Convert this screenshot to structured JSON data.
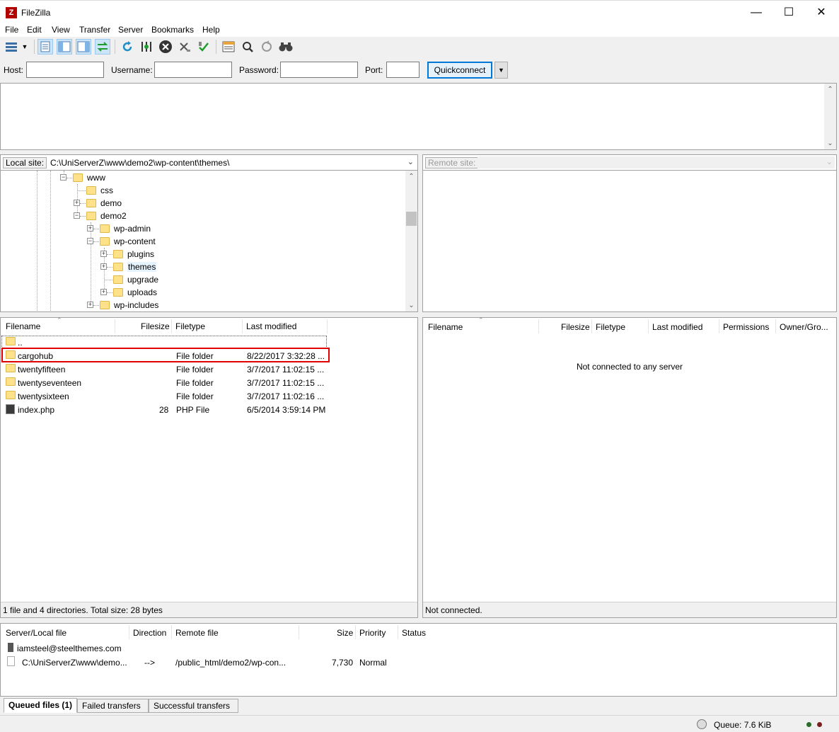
{
  "window": {
    "title": "FileZilla",
    "icon_text": "Z"
  },
  "menu": [
    "File",
    "Edit",
    "View",
    "Transfer",
    "Server",
    "Bookmarks",
    "Help"
  ],
  "quickconnect": {
    "host_label": "Host:",
    "username_label": "Username:",
    "password_label": "Password:",
    "port_label": "Port:",
    "button": "Quickconnect",
    "host": "",
    "username": "",
    "password": "",
    "port": ""
  },
  "local": {
    "label": "Local site:",
    "path": "C:\\UniServerZ\\www\\demo2\\wp-content\\themes\\",
    "tree": [
      "www",
      "css",
      "demo",
      "demo2",
      "wp-admin",
      "wp-content",
      "plugins",
      "themes",
      "upgrade",
      "uploads",
      "wp-includes"
    ],
    "columns": [
      "Filename",
      "Filesize",
      "Filetype",
      "Last modified"
    ],
    "files": [
      {
        "name": "..",
        "size": "",
        "type": "",
        "modified": ""
      },
      {
        "name": "cargohub",
        "size": "",
        "type": "File folder",
        "modified": "8/22/2017 3:32:28 ..."
      },
      {
        "name": "twentyfifteen",
        "size": "",
        "type": "File folder",
        "modified": "3/7/2017 11:02:15 ..."
      },
      {
        "name": "twentyseventeen",
        "size": "",
        "type": "File folder",
        "modified": "3/7/2017 11:02:15 ..."
      },
      {
        "name": "twentysixteen",
        "size": "",
        "type": "File folder",
        "modified": "3/7/2017 11:02:16 ..."
      },
      {
        "name": "index.php",
        "size": "28",
        "type": "PHP File",
        "modified": "6/5/2014 3:59:14 PM"
      }
    ],
    "status": "1 file and 4 directories. Total size: 28 bytes"
  },
  "remote": {
    "label": "Remote site:",
    "columns": [
      "Filename",
      "Filesize",
      "Filetype",
      "Last modified",
      "Permissions",
      "Owner/Gro..."
    ],
    "empty_message": "Not connected to any server",
    "status": "Not connected."
  },
  "queue": {
    "columns": [
      "Server/Local file",
      "Direction",
      "Remote file",
      "Size",
      "Priority",
      "Status"
    ],
    "server": "iamsteel@steelthemes.com",
    "item": {
      "local": "C:\\UniServerZ\\www\\demo...",
      "direction": "-->",
      "remote": "/public_html/demo2/wp-con...",
      "size": "7,730",
      "priority": "Normal"
    },
    "tabs": [
      "Queued files (1)",
      "Failed transfers",
      "Successful transfers"
    ]
  },
  "statusbar": {
    "queue": "Queue: 7.6 KiB"
  },
  "colors": {
    "highlight_box": "#e00000",
    "accent": "#0078d7"
  }
}
